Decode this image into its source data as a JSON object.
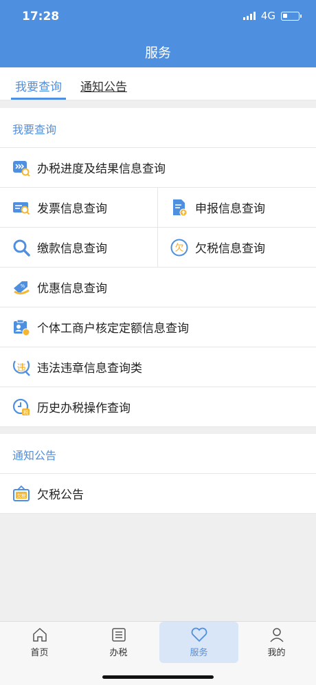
{
  "status_bar": {
    "time": "17:28",
    "network": "4G"
  },
  "header": {
    "title": "服务"
  },
  "tabs": [
    {
      "label": "我要查询"
    },
    {
      "label": "通知公告"
    }
  ],
  "query_section": {
    "title": "我要查询",
    "items": [
      {
        "label": "办税进度及结果信息查询",
        "icon": "progress-search-icon"
      },
      {
        "label": "发票信息查询",
        "icon": "invoice-search-icon"
      },
      {
        "label": "申报信息查询",
        "icon": "declaration-icon"
      },
      {
        "label": "缴款信息查询",
        "icon": "search-icon"
      },
      {
        "label": "欠税信息查询",
        "icon": "owed-tax-icon"
      },
      {
        "label": "优惠信息查询",
        "icon": "discount-icon"
      },
      {
        "label": "个体工商户核定定额信息查询",
        "icon": "business-icon"
      },
      {
        "label": "违法违章信息查询类",
        "icon": "violation-icon"
      },
      {
        "label": "历史办税操作查询",
        "icon": "history-icon"
      }
    ]
  },
  "notice_section": {
    "title": "通知公告",
    "items": [
      {
        "label": "欠税公告",
        "icon": "owed-tax-notice-icon"
      }
    ]
  },
  "icon_glyphs": {
    "owed_tax": "欠",
    "violation": "违",
    "notice": "欠税"
  },
  "bottom_nav": [
    {
      "label": "首页",
      "icon": "home-icon"
    },
    {
      "label": "办税",
      "icon": "list-icon"
    },
    {
      "label": "服务",
      "icon": "heart-icon",
      "active": true
    },
    {
      "label": "我的",
      "icon": "user-icon"
    }
  ],
  "colors": {
    "primary": "#4f8fdf",
    "background": "#efefef",
    "icon_yellow": "#f5b731"
  }
}
